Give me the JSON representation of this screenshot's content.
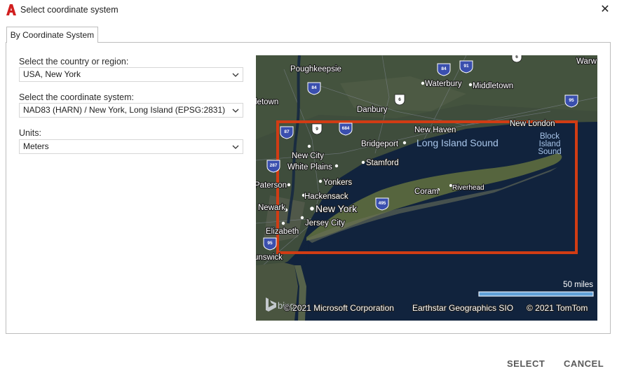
{
  "window": {
    "title": "Select coordinate system",
    "app_icon": "autocad-a-icon",
    "close_icon": "close-icon"
  },
  "tabs": [
    {
      "label": "By Coordinate System",
      "selected": true
    }
  ],
  "form": {
    "country": {
      "label": "Select the country or region:",
      "value": "USA, New York"
    },
    "coordinate_system": {
      "label": "Select the coordinate system:",
      "value": "NAD83 (HARN) / New York, Long Island (EPSG:2831)"
    },
    "units": {
      "label": "Units:",
      "value": "Meters"
    }
  },
  "map": {
    "places": [
      "Poughkeepsie",
      "Waterbury",
      "Middletown",
      "Danbury",
      "New Haven",
      "New London",
      "Bridgeport",
      "Stamford",
      "New City",
      "White Plains",
      "Yonkers",
      "Paterson",
      "Hackensack",
      "Newark",
      "New York",
      "Jersey City",
      "Elizabeth",
      "Coram",
      "Riverhead",
      "Warw",
      "letown",
      "unswick"
    ],
    "water_labels": [
      "Long Island Sound",
      "Block Island Sound"
    ],
    "highway_shields": [
      "84",
      "91",
      "84",
      "6",
      "95",
      "87",
      "9",
      "684",
      "287",
      "495",
      "95",
      "6"
    ],
    "scale_label": "50 miles",
    "attribution": [
      "© 2021 Microsoft Corporation",
      "Earthstar Geographics SIO",
      "© 2021 TomTom"
    ],
    "logo_text": "bing",
    "selection_color": "#d13c14",
    "water_color": "#11233d"
  },
  "buttons": {
    "select": "SELECT",
    "cancel": "CANCEL"
  }
}
